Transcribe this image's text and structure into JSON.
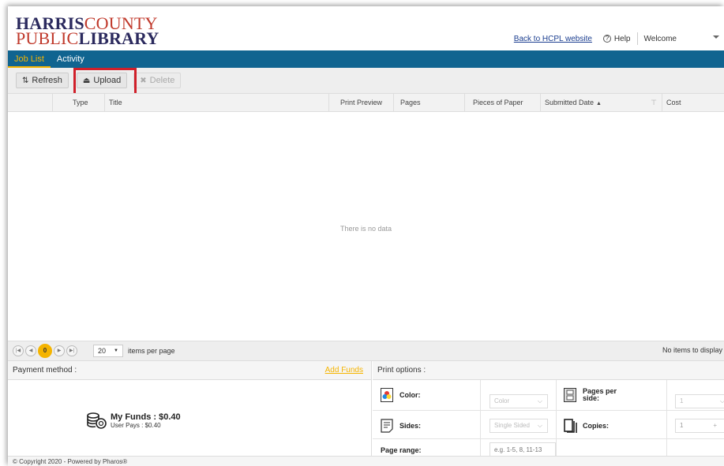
{
  "header": {
    "logo_line1_bold": "HARRIS",
    "logo_line1_thin": "COUNTY",
    "logo_line2_thin": "PUBLIC",
    "logo_line2_bold": "LIBRARY",
    "back_link": "Back to HCPL website",
    "help": "Help",
    "welcome": "Welcome"
  },
  "nav": {
    "tabs": [
      {
        "label": "Job List",
        "active": true
      },
      {
        "label": "Activity",
        "active": false
      }
    ]
  },
  "toolbar": {
    "refresh": "Refresh",
    "upload": "Upload",
    "delete": "Delete"
  },
  "grid": {
    "columns": [
      "Type",
      "Title",
      "Print Preview",
      "Pages",
      "Pieces of Paper",
      "Submitted Date",
      "Cost"
    ],
    "empty_message": "There is no data"
  },
  "pager": {
    "current_page": "0",
    "page_size": "20",
    "items_per_page": "items per page",
    "info": "No items to display"
  },
  "payment": {
    "title": "Payment method :",
    "add_funds": "Add Funds",
    "my_funds": "My Funds : $0.40",
    "user_pays": "User Pays : $0.40"
  },
  "print_options": {
    "title": "Print options :",
    "color_label": "Color:",
    "color_value": "Color",
    "pages_per_side_label": "Pages per side:",
    "pages_per_side_value": "1",
    "sides_label": "Sides:",
    "sides_value": "Single Sided",
    "copies_label": "Copies:",
    "copies_value": "1",
    "page_range_label": "Page range:",
    "page_range_placeholder": "e.g. 1-5, 8, 11-13"
  },
  "footer": {
    "copyright": "© Copyright 2020 - Powered by Pharos®"
  },
  "colors": {
    "nav_bg": "#106490",
    "accent": "#f5b400",
    "highlight": "#d0202a"
  }
}
